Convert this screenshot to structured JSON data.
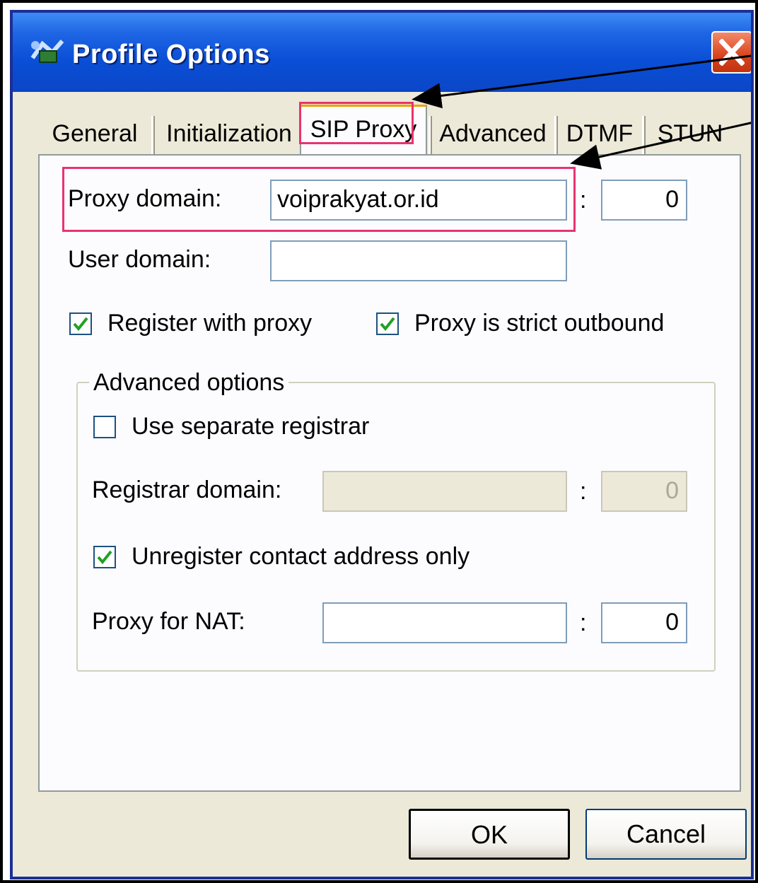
{
  "window": {
    "title": "Profile Options",
    "close_glyph": "close-icon"
  },
  "tabs": [
    {
      "label": "General"
    },
    {
      "label": "Initialization"
    },
    {
      "label": "SIP Proxy",
      "active": true
    },
    {
      "label": "Advanced"
    },
    {
      "label": "DTMF"
    },
    {
      "label": "STUN"
    }
  ],
  "form": {
    "proxy_domain_label": "Proxy domain:",
    "proxy_domain_value": "voiprakyat.or.id",
    "proxy_port_value": "0",
    "colon": ":",
    "user_domain_label": "User domain:",
    "user_domain_value": "",
    "register_with_proxy_label": "Register with proxy",
    "register_with_proxy_checked": true,
    "strict_outbound_label": "Proxy is strict outbound",
    "strict_outbound_checked": true
  },
  "advanced_group": {
    "title": "Advanced options",
    "separate_registrar_label": "Use separate registrar",
    "separate_registrar_checked": false,
    "registrar_domain_label": "Registrar domain:",
    "registrar_domain_value": "",
    "registrar_port_value": "0",
    "unregister_contact_label": "Unregister contact address only",
    "unregister_contact_checked": true,
    "nat_proxy_label": "Proxy for NAT:",
    "nat_proxy_value": "",
    "nat_port_value": "0"
  },
  "buttons": {
    "ok_label": "OK",
    "cancel_label": "Cancel"
  },
  "annotation": {
    "highlight_color": "#e8336e"
  }
}
